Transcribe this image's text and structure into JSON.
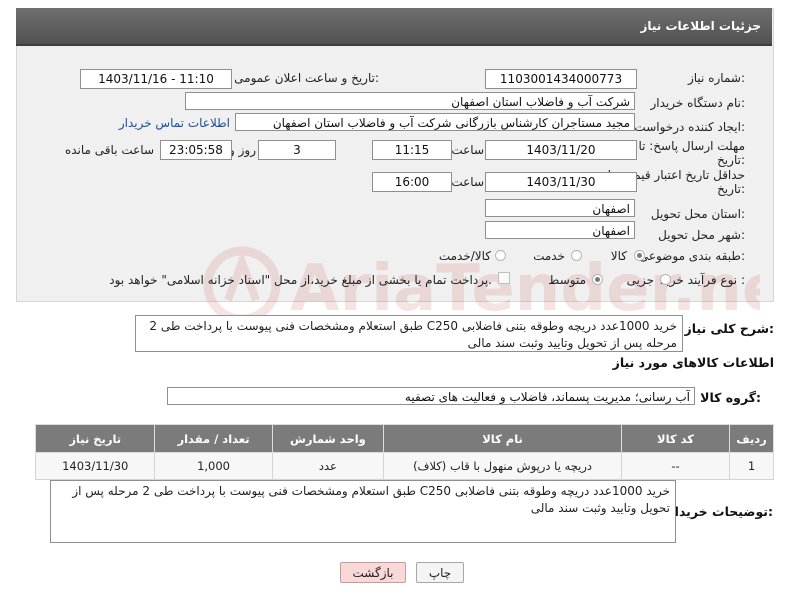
{
  "panel": {
    "title": "جزئیات اطلاعات نیاز"
  },
  "fields": {
    "need_number_label": "شماره نیاز:",
    "need_number": "1103001434000773",
    "announce_label": "تاریخ و ساعت اعلان عمومی:",
    "announce_value": "1403/11/16 - 11:10",
    "buyer_label": "نام دستگاه خریدار:",
    "buyer": "شرکت آب و فاضلاب استان اصفهان",
    "creator_label": "ایجاد کننده درخواست:",
    "creator": "مجید مستاجران کارشناس بازرگانی شرکت آب و فاضلاب استان اصفهان",
    "contact_link": "اطلاعات تماس خریدار",
    "deadline_label_line1": "مهلت ارسال پاسخ: تا",
    "deadline_label_line2": "تاریخ:",
    "deadline_date": "1403/11/20",
    "time_label": "ساعت",
    "deadline_time": "11:15",
    "days_value": "3",
    "days_label": "روز و",
    "remaining_time": "23:05:58",
    "remaining_label": "ساعت باقی مانده",
    "validity_label_line1": "حداقل تاریخ اعتبار قیمت: تا",
    "validity_label_line2": "تاریخ:",
    "validity_date": "1403/11/30",
    "validity_time_label": "ساعت",
    "validity_time": "16:00",
    "province_label": "استان محل تحویل:",
    "province": "اصفهان",
    "city_label": "شهر محل تحویل:",
    "city": "اصفهان",
    "category_label": "طبقه بندی موضوعی:",
    "category_options": [
      "کالا",
      "خدمت",
      "کالا/خدمت"
    ],
    "process_label": "نوع فرآیند خرید :",
    "process_options": [
      "جزیی",
      "متوسط"
    ],
    "payment_note": "پرداخت تمام یا بخشی از مبلغ خرید،از محل \"اسناد خزانه اسلامی\" خواهد بود."
  },
  "description": {
    "label": "شرح کلی نیاز:",
    "text": "خرید 1000عدد دریچه وطوقه بتنی فاضلابی C250 طبق استعلام ومشخصات فنی پیوست با پرداخت طی 2 مرحله پس از تحویل وتایید وثبت سند مالی"
  },
  "goods": {
    "section_title": "اطلاعات کالاهای مورد نیاز",
    "group_label": "گروه کالا:",
    "group_value": "آب رسانی؛ مدیریت پسماند، فاضلاب و فعالیت های تصفیه",
    "columns": [
      "ردیف",
      "کد کالا",
      "نام کالا",
      "واحد شمارش",
      "تعداد / مقدار",
      "تاریخ نیاز"
    ],
    "rows": [
      [
        "1",
        "--",
        "دریچه یا درپوش منهول با قاب (کلاف)",
        "عدد",
        "1,000",
        "1403/11/30"
      ]
    ]
  },
  "buyer_notes": {
    "label": "توضیحات خریدار:",
    "text": "خرید 1000عدد دریچه وطوقه بتنی فاضلابی C250 طبق استعلام ومشخصات فنی پیوست با پرداخت طی 2 مرحله پس از تحویل وتایید وثبت سند مالی"
  },
  "buttons": {
    "print": "چاپ",
    "back": "بازگشت"
  },
  "watermark": {
    "text": "AriaTender.neT"
  },
  "colors": {
    "header": "#5e5e5e",
    "link": "#1a4fa0",
    "back_button": "#f8d8d8",
    "watermark": "#c0392b"
  }
}
